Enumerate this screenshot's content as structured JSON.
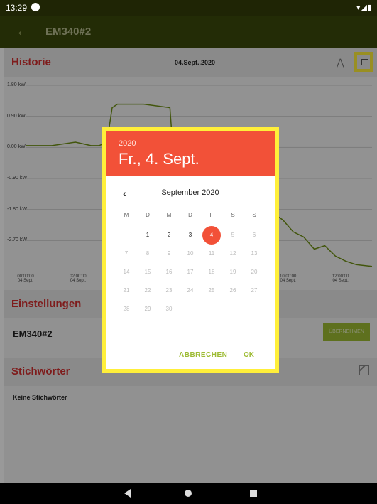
{
  "status_bar": {
    "time": "13:29",
    "icons": "▾◢▮"
  },
  "app_bar": {
    "title": "EM340#2",
    "back_icon": "←"
  },
  "history": {
    "title": "Historie",
    "date_range": "04.Sept..2020",
    "trend_icon": "⋀",
    "calendar_icon": "calendar-icon"
  },
  "chart_data": {
    "type": "line",
    "y_tick_labels": [
      "1.80 kW",
      "0.90 kW",
      "0.00 kW",
      "-0.90 kW",
      "-1.80 kW",
      "-2.70 kW"
    ],
    "x_tick_labels": [
      {
        "time": "00:00:00",
        "day": "04 Sept."
      },
      {
        "time": "02:00:00",
        "day": "04 Sept."
      },
      {
        "time": "10:00:00",
        "day": "04 Sept."
      },
      {
        "time": "12:00:00",
        "day": "04 Sept."
      }
    ],
    "x_hours": [
      0,
      1,
      1.9,
      2.5,
      2.8,
      3.1,
      3.3,
      3.5,
      4.5,
      5.5,
      5.6,
      6.2,
      6.6,
      7.5,
      8.0,
      8.5,
      9.0,
      9.5,
      9.8,
      10.2,
      10.6,
      11.0,
      11.4,
      11.8,
      12.2,
      12.6,
      13.2
    ],
    "y_values": [
      0.05,
      0.05,
      0.15,
      0.05,
      0.05,
      0.15,
      1.15,
      1.25,
      1.25,
      1.15,
      0.1,
      0.1,
      0.05,
      -0.2,
      -0.9,
      -1.4,
      -1.8,
      -1.95,
      -2.1,
      -2.45,
      -2.6,
      -2.95,
      -2.85,
      -3.15,
      -3.3,
      -3.4,
      -3.45
    ],
    "ylim": [
      -3.6,
      1.8
    ],
    "xlim": [
      0,
      13.2
    ],
    "line_color": "#6f8f14"
  },
  "settings": {
    "title": "Einstellungen",
    "name_value": "EM340#2",
    "apply_label": "ÜBERNEHMEN"
  },
  "keywords": {
    "title": "Stichwörter",
    "empty_text": "Keine Stichwörter"
  },
  "date_picker": {
    "year": "2020",
    "selected_label": "Fr., 4. Sept.",
    "month_label": "September 2020",
    "prev_icon": "‹",
    "weekdays": [
      "M",
      "D",
      "M",
      "D",
      "F",
      "S",
      "S"
    ],
    "days": [
      "1",
      "2",
      "3",
      "4",
      "5",
      "6",
      "7",
      "8",
      "9",
      "10",
      "11",
      "12",
      "13",
      "14",
      "15",
      "16",
      "17",
      "18",
      "19",
      "20",
      "21",
      "22",
      "23",
      "24",
      "25",
      "26",
      "27",
      "28",
      "29",
      "30"
    ],
    "first_weekday_index": 1,
    "selected_day": 4,
    "last_enabled_day": 4,
    "cancel_label": "ABBRECHEN",
    "ok_label": "OK"
  },
  "colors": {
    "accent": "#f25138",
    "brand": "#3b4a0b",
    "highlight": "#ffef3a",
    "action": "#9dbb33"
  }
}
